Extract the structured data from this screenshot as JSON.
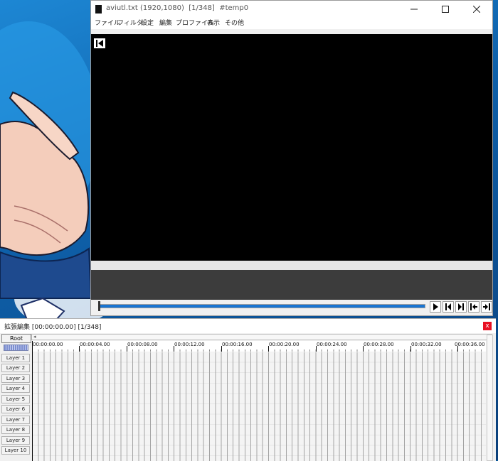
{
  "main_window": {
    "title": "aviutl.txt (1920,1080)  [1/348]  #temp0",
    "menu": [
      "ファイル",
      "フィルタ",
      "設定",
      "編集",
      "プロファイル",
      "表示",
      "その他"
    ],
    "icons": {
      "minimize": "minimize-icon",
      "maximize": "maximize-icon",
      "close": "close-icon",
      "jump_start": "jump-to-start-icon"
    },
    "playback_icons": [
      "play-icon",
      "prev-frame-icon",
      "next-frame-icon",
      "skip-to-start-icon",
      "skip-to-end-icon"
    ],
    "seek_position": 0.0
  },
  "ext_window": {
    "title": "拡張編集 [00:00:00.00] [1/348]",
    "close_label": "x",
    "root_label": "Root",
    "ruler_ticks": [
      "00:00:00.00",
      "00:00:04.00",
      "00:00:08.00",
      "00:00:12.00",
      "00:00:16.00",
      "00:00:20.00",
      "00:00:24.00",
      "00:00:28.00",
      "00:00:32.00",
      "00:00:36.00"
    ],
    "layers": [
      "Layer 1",
      "Layer 2",
      "Layer 3",
      "Layer 4",
      "Layer 5",
      "Layer 6",
      "Layer 7",
      "Layer 8",
      "Layer 9",
      "Layer 10"
    ]
  },
  "colors": {
    "seek_bar": "#1874d1",
    "preview_bg": "#000000",
    "close_red": "#e81123"
  }
}
